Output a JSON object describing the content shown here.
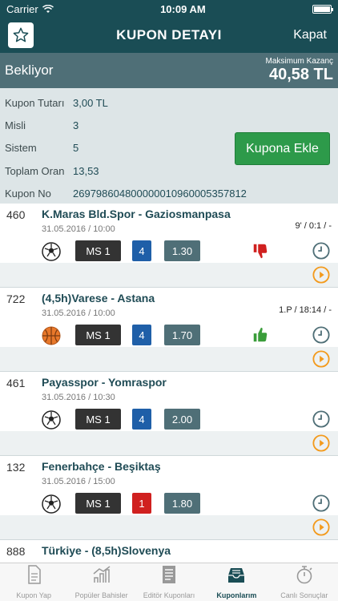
{
  "status": {
    "carrier": "Carrier",
    "time": "10:09 AM"
  },
  "nav": {
    "title": "KUPON DETAYI",
    "close_label": "Kapat"
  },
  "state": {
    "label": "Bekliyor",
    "max_win_label": "Maksimum Kazanç",
    "max_win_value": "40,58 TL"
  },
  "summary": {
    "rows": [
      {
        "key": "Kupon Tutarı",
        "value": "3,00 TL"
      },
      {
        "key": "Misli",
        "value": "3"
      },
      {
        "key": "Sistem",
        "value": "5"
      },
      {
        "key": "Toplam Oran",
        "value": "13,53"
      },
      {
        "key": "Kupon No",
        "value": "26979860480000001096000535781 2"
      }
    ],
    "add_button": "Kupona Ekle"
  },
  "matches": [
    {
      "code": "460",
      "teams": "K.Maras Bld.Spor - Gaziosmanpasa",
      "date": "31.05.2016 / 10:00",
      "score": "9' / 0:1 / -",
      "sport": "football",
      "bet": "MS 1",
      "num": "4",
      "num_color": "#1f5fa8",
      "odd": "1.30",
      "result": "lost"
    },
    {
      "code": "722",
      "teams": "(4,5h)Varese - Astana",
      "date": "31.05.2016 / 10:00",
      "score": "1.P / 18:14 / -",
      "sport": "basketball",
      "bet": "MS 1",
      "num": "4",
      "num_color": "#1f5fa8",
      "odd": "1.70",
      "result": "won"
    },
    {
      "code": "461",
      "teams": "Payasspor - Yomraspor",
      "date": "31.05.2016 / 10:30",
      "score": "",
      "sport": "football",
      "bet": "MS 1",
      "num": "4",
      "num_color": "#1f5fa8",
      "odd": "2.00",
      "result": ""
    },
    {
      "code": "132",
      "teams": "Fenerbahçe - Beşiktaş",
      "date": "31.05.2016 / 15:00",
      "score": "",
      "sport": "football",
      "bet": "MS 1",
      "num": "1",
      "num_color": "#d0201f",
      "odd": "1.80",
      "result": ""
    },
    {
      "code": "888",
      "teams": "Türkiye - (8,5h)Slovenya",
      "date": "",
      "score": "",
      "sport": "",
      "bet": "",
      "num": "",
      "num_color": "",
      "odd": "",
      "result": ""
    }
  ],
  "tabs": [
    {
      "label": "Kupon Yap",
      "icon": "document-icon",
      "active": false
    },
    {
      "label": "Popüler Bahisler",
      "icon": "chart-icon",
      "active": false
    },
    {
      "label": "Editör Kuponları",
      "icon": "editor-document-icon",
      "active": false
    },
    {
      "label": "Kuponlarım",
      "icon": "inbox-icon",
      "active": true
    },
    {
      "label": "Canlı Sonuçlar",
      "icon": "stopwatch-icon",
      "active": false
    }
  ]
}
